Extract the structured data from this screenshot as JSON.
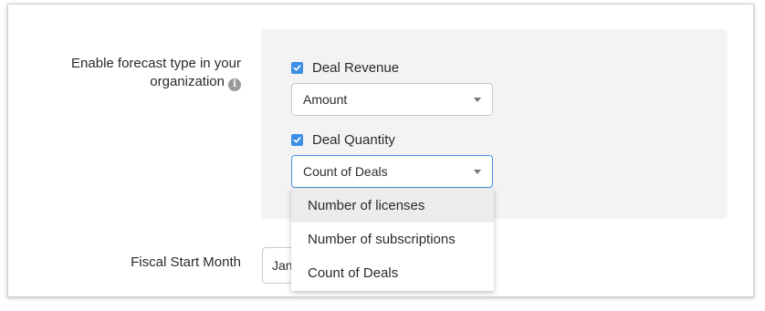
{
  "forecast": {
    "label_line1": "Enable forecast type in your",
    "label_line2": "organization",
    "info_icon": "info-icon"
  },
  "deal_revenue": {
    "checkbox_label": "Deal Revenue",
    "checked": true,
    "select_value": "Amount"
  },
  "deal_quantity": {
    "checkbox_label": "Deal Quantity",
    "checked": true,
    "select_value": "Count of Deals"
  },
  "dropdown": {
    "options": [
      "Number of licenses",
      "Number of subscriptions",
      "Count of Deals"
    ],
    "highlighted": "Number of licenses"
  },
  "fiscal": {
    "label": "Fiscal Start Month",
    "value_visible": "Jan"
  },
  "colors": {
    "accent": "#3b8fe5",
    "panel_bg": "#f3f3f3"
  }
}
